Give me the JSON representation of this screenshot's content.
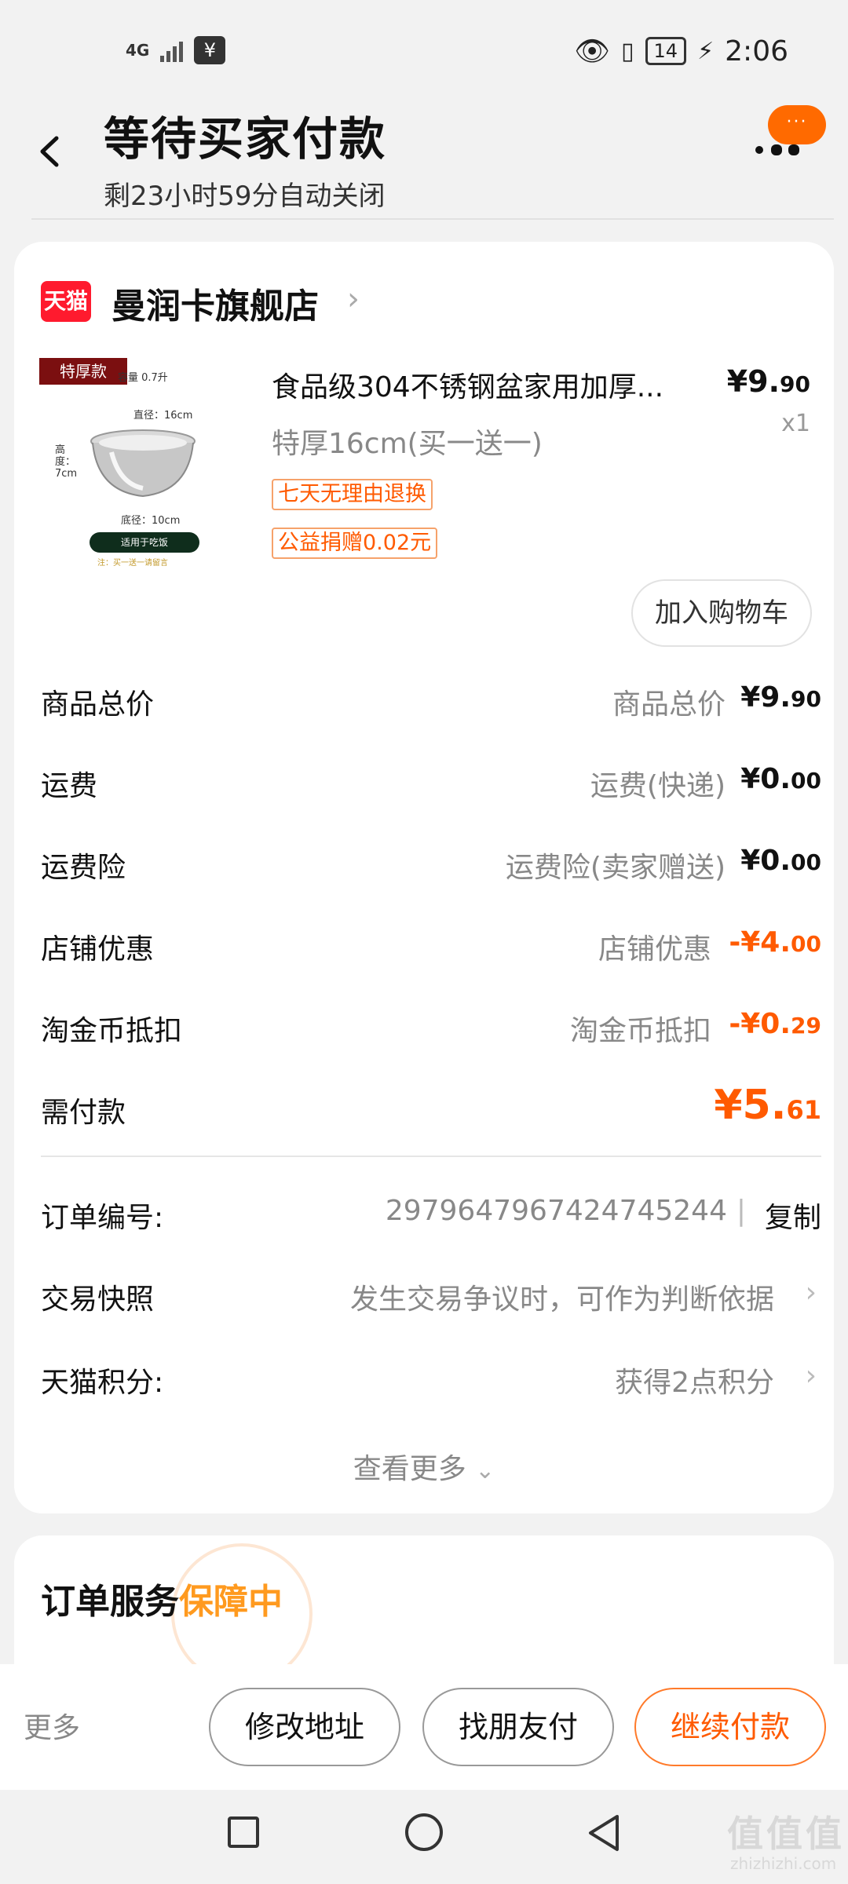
{
  "status_bar": {
    "network": "4G",
    "battery": "14",
    "time": "2:06"
  },
  "header": {
    "title": "等待买家付款",
    "subtitle": "剩23小时59分自动关闭",
    "bubble": "···"
  },
  "shop": {
    "platform_badge": "天猫",
    "name": "曼润卡旗舰店"
  },
  "product": {
    "image_tag": "特厚款",
    "image_capacity": "容量 0.7升",
    "image_diameter": "直径：16cm",
    "image_height": "高度：7cm",
    "image_base": "底径：10cm",
    "image_bar": "适用于吃饭",
    "image_note": "注：买一送一请留言",
    "title": "食品级304不锈钢盆家用加厚...",
    "price_main": "¥9.",
    "price_decimal": "90",
    "quantity": "x1",
    "spec": "特厚16cm(买一送一)",
    "tags": [
      "七天无理由退换",
      "公益捐赠0.02元"
    ],
    "add_to_cart": "加入购物车"
  },
  "price_rows": [
    {
      "label": "商品总价",
      "detail": "商品总价",
      "value_main": "¥9.",
      "value_decimal": "90"
    },
    {
      "label": "运费",
      "detail": "运费(快递)",
      "value_main": "¥0.",
      "value_decimal": "00"
    },
    {
      "label": "运费险",
      "detail": "运费险(卖家赠送)",
      "value_main": "¥0.",
      "value_decimal": "00"
    },
    {
      "label": "店铺优惠",
      "detail": "店铺优惠",
      "value_main": "-¥4.",
      "value_decimal": "00"
    },
    {
      "label": "淘金币抵扣",
      "detail": "淘金币抵扣",
      "value_main": "-¥0.",
      "value_decimal": "29"
    }
  ],
  "total": {
    "label": "需付款",
    "value_main": "¥5.",
    "value_decimal": "61"
  },
  "info_rows": {
    "order_no_label": "订单编号:",
    "order_no": "2979647967424745244",
    "copy": "复制",
    "snapshot_label": "交易快照",
    "snapshot_value": "发生交易争议时，可作为判断依据",
    "points_label": "天猫积分:",
    "points_value": "获得2点积分"
  },
  "see_more": "查看更多",
  "service": {
    "title": "订单服务",
    "status": "保障中"
  },
  "action_bar": {
    "more": "更多",
    "modify_address": "修改地址",
    "friend_pay": "找朋友付",
    "continue_pay": "继续付款"
  },
  "watermark": {
    "main": "值值值",
    "sub": "zhizhizhi.com"
  }
}
